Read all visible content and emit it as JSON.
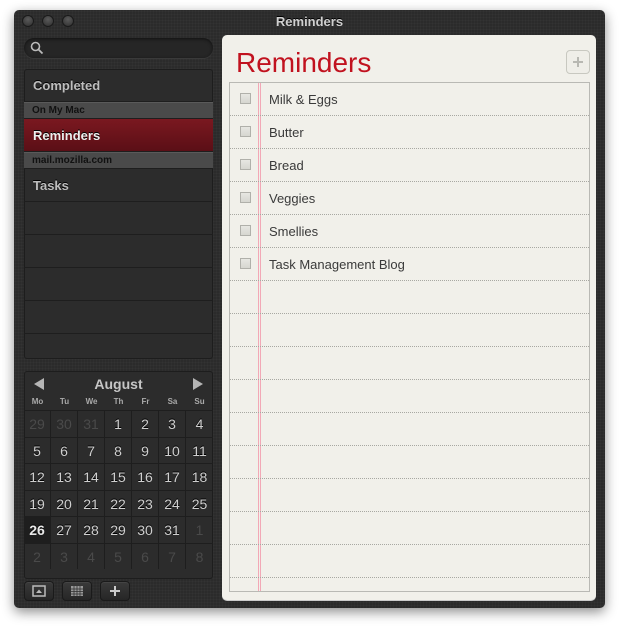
{
  "window": {
    "title": "Reminders"
  },
  "search": {
    "placeholder": "",
    "value": ""
  },
  "sidebar": {
    "completed_label": "Completed",
    "groups": [
      {
        "header": "On My Mac",
        "lists": [
          {
            "label": "Reminders",
            "selected": true
          }
        ]
      },
      {
        "header": "mail.mozilla.com",
        "lists": [
          {
            "label": "Tasks",
            "selected": false
          }
        ]
      }
    ]
  },
  "calendar": {
    "month": "August",
    "weekdays": [
      "Mo",
      "Tu",
      "We",
      "Th",
      "Fr",
      "Sa",
      "Su"
    ],
    "weeks": [
      [
        "29",
        "30",
        "31",
        "1",
        "2",
        "3",
        "4"
      ],
      [
        "5",
        "6",
        "7",
        "8",
        "9",
        "10",
        "11"
      ],
      [
        "12",
        "13",
        "14",
        "15",
        "16",
        "17",
        "18"
      ],
      [
        "19",
        "20",
        "21",
        "22",
        "23",
        "24",
        "25"
      ],
      [
        "26",
        "27",
        "28",
        "29",
        "30",
        "31",
        "1"
      ],
      [
        "2",
        "3",
        "4",
        "5",
        "6",
        "7",
        "8"
      ]
    ],
    "other_month_cells": [
      0,
      1,
      2,
      34,
      35,
      36,
      37,
      38,
      39,
      40,
      41
    ],
    "today_cell": 28
  },
  "toolbar": {
    "buttons": [
      {
        "name": "show-info-button",
        "icon": "info-panel-icon"
      },
      {
        "name": "show-calendar-button",
        "icon": "calendar-grid-icon"
      },
      {
        "name": "add-list-button",
        "icon": "plus-icon"
      }
    ]
  },
  "main": {
    "title": "Reminders",
    "add_label": "+",
    "tasks": [
      {
        "text": "Milk & Eggs",
        "done": false
      },
      {
        "text": "Butter",
        "done": false
      },
      {
        "text": "Bread",
        "done": false
      },
      {
        "text": "Veggies",
        "done": false
      },
      {
        "text": "Smellies",
        "done": false
      },
      {
        "text": "Task Management Blog",
        "done": false
      }
    ]
  },
  "colors": {
    "accent_red": "#c1121f",
    "selected_list": "#6b141b",
    "paper": "#f1f0ea",
    "margin_line": "#f2a8b6"
  }
}
